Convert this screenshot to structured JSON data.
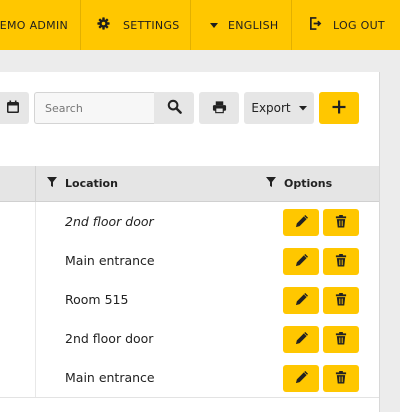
{
  "topbar": {
    "user_label": "DEMO ADMIN",
    "settings_label": "SETTINGS",
    "language_label": "ENGLISH",
    "logout_label": "LOG OUT"
  },
  "toolbar": {
    "search_placeholder": "Search",
    "export_label": "Export"
  },
  "table": {
    "columns": [
      "Location",
      "Options"
    ],
    "rows": [
      {
        "location": "2nd floor door",
        "italic": true
      },
      {
        "location": "Main entrance"
      },
      {
        "location": "Room 515"
      },
      {
        "location": "2nd floor door"
      },
      {
        "location": "Main entrance"
      }
    ]
  },
  "colors": {
    "accent": "#ffc700",
    "background": "#ececec",
    "button_gray": "#e6e6e6"
  },
  "icons": [
    "gear-icon",
    "caret-down-icon",
    "logout-icon",
    "calendar-icon",
    "search-icon",
    "print-icon",
    "plus-icon",
    "filter-icon",
    "pencil-icon",
    "trash-icon"
  ]
}
